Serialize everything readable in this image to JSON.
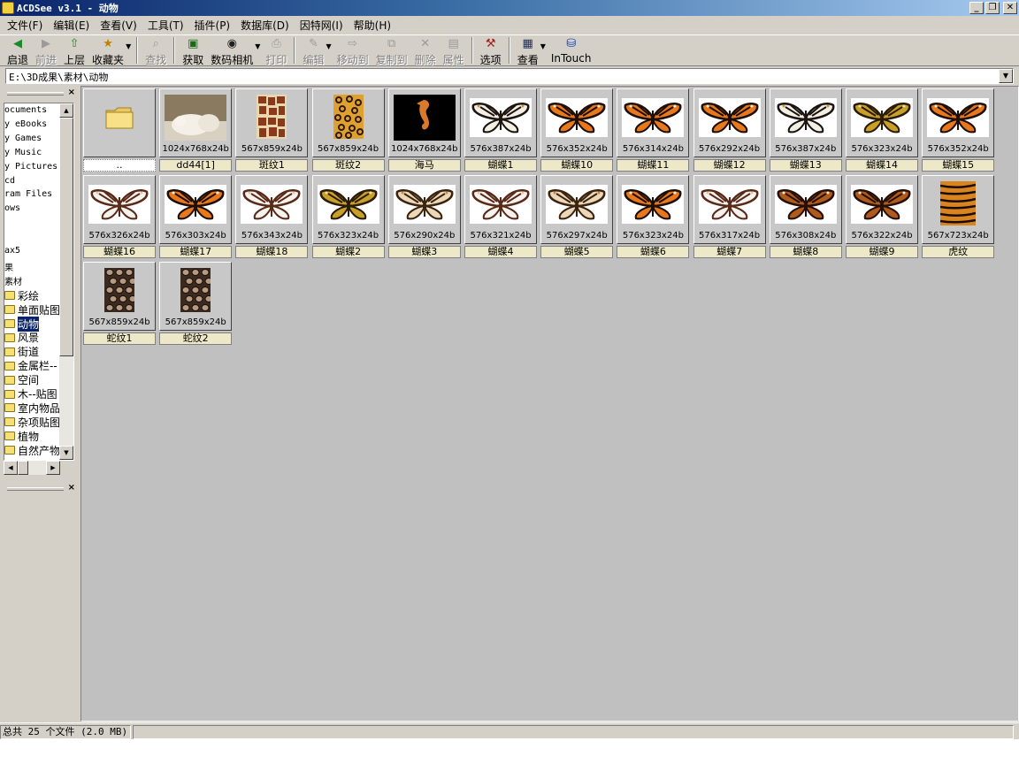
{
  "window": {
    "title": "ACDSee v3.1 - 动物"
  },
  "menu": [
    "文件(F)",
    "编辑(E)",
    "查看(V)",
    "工具(T)",
    "插件(P)",
    "数据库(D)",
    "因特网(I)",
    "帮助(H)"
  ],
  "toolbar": [
    {
      "label": "启退",
      "icon": "back-icon",
      "enabled": true
    },
    {
      "label": "前进",
      "icon": "forward-icon",
      "enabled": false
    },
    {
      "label": "上层",
      "icon": "up-folder-icon",
      "enabled": true
    },
    {
      "label": "收藏夹",
      "icon": "favorites-icon",
      "enabled": true,
      "dropdown": true
    },
    {
      "label": "查找",
      "icon": "find-icon",
      "enabled": false
    },
    {
      "label": "获取",
      "icon": "acquire-icon",
      "enabled": true
    },
    {
      "label": "数码相机",
      "icon": "camera-icon",
      "enabled": true,
      "dropdown": true
    },
    {
      "label": "打印",
      "icon": "print-icon",
      "enabled": false
    },
    {
      "label": "编辑",
      "icon": "edit-icon",
      "enabled": false,
      "dropdown": true
    },
    {
      "label": "移动到",
      "icon": "move-to-icon",
      "enabled": false
    },
    {
      "label": "复制到",
      "icon": "copy-to-icon",
      "enabled": false
    },
    {
      "label": "删除",
      "icon": "delete-icon",
      "enabled": false
    },
    {
      "label": "属性",
      "icon": "properties-icon",
      "enabled": false
    },
    {
      "label": "选项",
      "icon": "options-icon",
      "enabled": true
    },
    {
      "label": "查看",
      "icon": "view-icon",
      "enabled": true,
      "dropdown": true
    },
    {
      "label": "InTouch",
      "icon": "intouch-icon",
      "enabled": true
    }
  ],
  "address": {
    "path": "E:\\3D成果\\素材\\动物"
  },
  "tree": {
    "items": [
      {
        "label": "ocuments",
        "folder": false
      },
      {
        "label": "y eBooks",
        "folder": false
      },
      {
        "label": "y Games",
        "folder": false
      },
      {
        "label": "y Music",
        "folder": false
      },
      {
        "label": "y Pictures",
        "folder": false
      },
      {
        "label": "cd",
        "folder": false
      },
      {
        "label": "ram Files",
        "folder": false
      },
      {
        "label": "ows",
        "folder": false
      },
      {
        "label": "",
        "folder": false
      },
      {
        "label": "",
        "folder": false
      },
      {
        "label": "ax5",
        "folder": false
      },
      {
        "label": "果",
        "folder": false
      },
      {
        "label": "素材",
        "folder": false
      },
      {
        "label": "彩绘",
        "folder": true
      },
      {
        "label": "单面贴图",
        "folder": true
      },
      {
        "label": "动物",
        "folder": true,
        "selected": true
      },
      {
        "label": "风景",
        "folder": true
      },
      {
        "label": "街道",
        "folder": true
      },
      {
        "label": "金属栏--",
        "folder": true
      },
      {
        "label": "空间",
        "folder": true
      },
      {
        "label": "木--贴图",
        "folder": true
      },
      {
        "label": "室内物品",
        "folder": true
      },
      {
        "label": "杂项贴图",
        "folder": true
      },
      {
        "label": "植物",
        "folder": true
      },
      {
        "label": "自然产物",
        "folder": true
      }
    ]
  },
  "files": [
    {
      "name": "..",
      "dims": "",
      "kind": "folder"
    },
    {
      "name": "dd44[1]",
      "dims": "1024x768x24b",
      "kind": "polar"
    },
    {
      "name": "斑纹1",
      "dims": "567x859x24b",
      "kind": "giraffe"
    },
    {
      "name": "斑纹2",
      "dims": "567x859x24b",
      "kind": "leopard"
    },
    {
      "name": "海马",
      "dims": "1024x768x24b",
      "kind": "seahorse"
    },
    {
      "name": "蝴蝶1",
      "dims": "576x387x24b",
      "kind": "bfly-stripe"
    },
    {
      "name": "蝴蝶10",
      "dims": "576x352x24b",
      "kind": "bfly-orange"
    },
    {
      "name": "蝴蝶11",
      "dims": "576x314x24b",
      "kind": "bfly-orange"
    },
    {
      "name": "蝴蝶12",
      "dims": "576x292x24b",
      "kind": "bfly-orange"
    },
    {
      "name": "蝴蝶13",
      "dims": "576x387x24b",
      "kind": "bfly-stripe"
    },
    {
      "name": "蝴蝶14",
      "dims": "576x323x24b",
      "kind": "bfly-yellow"
    },
    {
      "name": "蝴蝶15",
      "dims": "576x352x24b",
      "kind": "bfly-orange"
    },
    {
      "name": "蝴蝶16",
      "dims": "576x326x24b",
      "kind": "bfly-clear"
    },
    {
      "name": "蝴蝶17",
      "dims": "576x303x24b",
      "kind": "bfly-orange"
    },
    {
      "name": "蝴蝶18",
      "dims": "576x343x24b",
      "kind": "bfly-clear"
    },
    {
      "name": "蝴蝶2",
      "dims": "576x323x24b",
      "kind": "bfly-yellow"
    },
    {
      "name": "蝴蝶3",
      "dims": "576x290x24b",
      "kind": "bfly-tan"
    },
    {
      "name": "蝴蝶4",
      "dims": "576x321x24b",
      "kind": "bfly-clear"
    },
    {
      "name": "蝴蝶5",
      "dims": "576x297x24b",
      "kind": "bfly-tan"
    },
    {
      "name": "蝴蝶6",
      "dims": "576x323x24b",
      "kind": "bfly-orange"
    },
    {
      "name": "蝴蝶7",
      "dims": "576x317x24b",
      "kind": "bfly-clear"
    },
    {
      "name": "蝴蝶8",
      "dims": "576x308x24b",
      "kind": "bfly-brown"
    },
    {
      "name": "蝴蝶9",
      "dims": "576x322x24b",
      "kind": "bfly-brown"
    },
    {
      "name": "虎纹",
      "dims": "567x723x24b",
      "kind": "tiger"
    },
    {
      "name": "蛇纹1",
      "dims": "567x859x24b",
      "kind": "snake"
    },
    {
      "name": "蛇纹2",
      "dims": "567x859x24b",
      "kind": "snake"
    }
  ],
  "status": {
    "summary": "总共 25 个文件 (2.0 MB)",
    "second": ""
  }
}
